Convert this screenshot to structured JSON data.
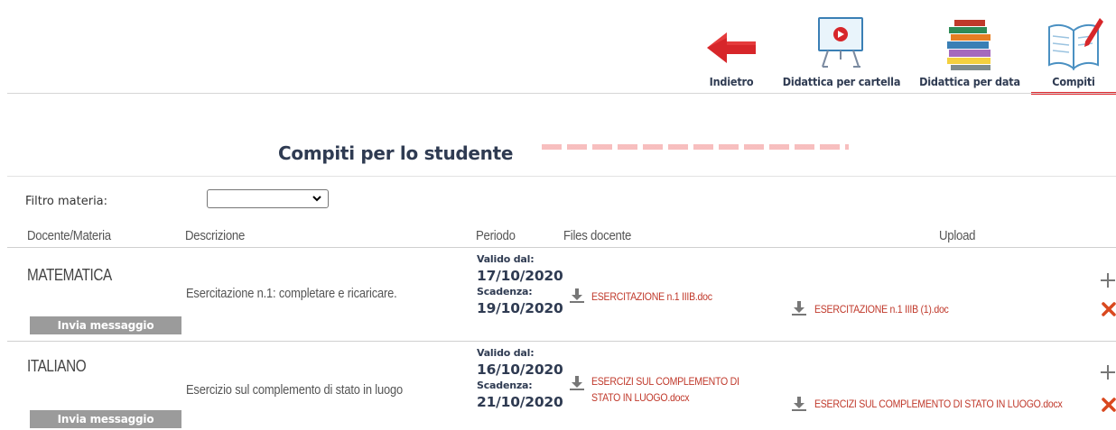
{
  "nav": {
    "items": [
      {
        "label": "Indietro",
        "icon": "back-arrow-icon"
      },
      {
        "label": "Didattica per cartella",
        "icon": "whiteboard-play-icon"
      },
      {
        "label": "Didattica per data",
        "icon": "book-stack-icon"
      },
      {
        "label": "Compiti",
        "icon": "open-book-pen-icon",
        "active": true
      }
    ]
  },
  "page": {
    "title": "Compiti per lo studente"
  },
  "filter": {
    "label": "Filtro materia:",
    "selected": ""
  },
  "table": {
    "headers": {
      "docente": "Docente/Materia",
      "descrizione": "Descrizione",
      "periodo": "Periodo",
      "files": "Files docente",
      "upload": "Upload"
    },
    "rows": [
      {
        "materia": "MATEMATICA",
        "button": "Invia messaggio",
        "descrizione": "Esercitazione n.1: completare e ricaricare.",
        "valido_label": "Valido dal:",
        "valido": "17/10/2020",
        "scadenza_label": "Scadenza:",
        "scadenza": "19/10/2020",
        "file_docente": "ESERCITAZIONE n.1 IIIB.doc",
        "file_upload": "ESERCITAZIONE n.1 IIIB (1).doc"
      },
      {
        "materia": "ITALIANO",
        "button": "Invia messaggio",
        "descrizione": "Esercizio sul complemento di stato in luogo",
        "valido_label": "Valido dal:",
        "valido": "16/10/2020",
        "scadenza_label": "Scadenza:",
        "scadenza": "21/10/2020",
        "file_docente_line1": "ESERCIZI SUL COMPLEMENTO DI",
        "file_docente_line2": "STATO IN LUOGO.docx",
        "file_upload": "ESERCIZI SUL COMPLEMENTO DI STATO IN LUOGO.docx"
      }
    ]
  },
  "colors": {
    "accent": "#e0262b",
    "link": "#c0392b",
    "heading": "#2f3b52",
    "button_bg": "#9b9b9b"
  }
}
